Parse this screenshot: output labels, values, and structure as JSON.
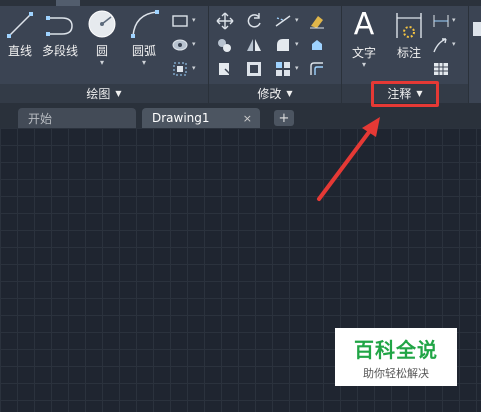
{
  "ribbon": {
    "panels": {
      "draw": {
        "label": "绘图"
      },
      "modify": {
        "label": "修改"
      },
      "annotation": {
        "label": "注释"
      }
    },
    "tools": {
      "line": "直线",
      "polyline": "多段线",
      "circle": "圆",
      "arc": "圆弧",
      "text": "文字",
      "dimension": "标注"
    }
  },
  "doc_tabs": {
    "start": "开始",
    "drawing": "Drawing1",
    "close_glyph": "×",
    "add_glyph": "+"
  },
  "watermark": {
    "title": "百科全说",
    "subtitle": "助你轻松解决"
  },
  "colors": {
    "ribbon": "#3b4453",
    "canvas": "#1f2530",
    "highlight": "#e53935",
    "watermark_green": "#21a546"
  }
}
